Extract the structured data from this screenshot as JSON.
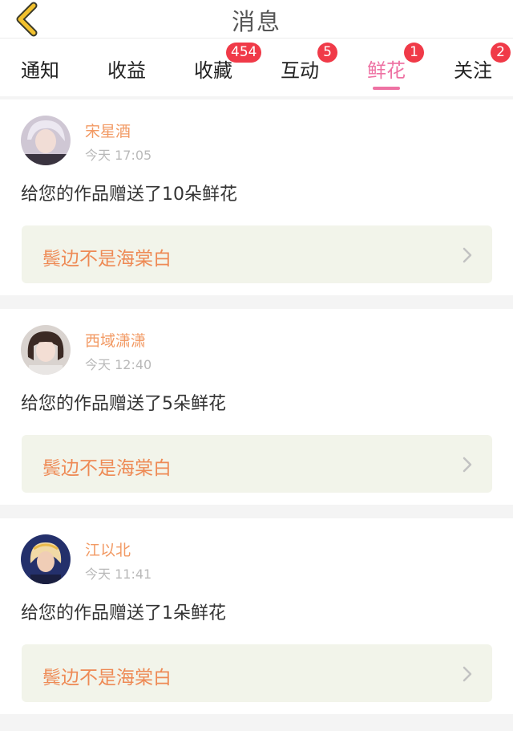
{
  "header": {
    "title": "消息",
    "back_icon": "chevron-left-icon",
    "back_color": "#f2c12e"
  },
  "tabs": [
    {
      "label": "通知",
      "badge": "",
      "active": false
    },
    {
      "label": "收益",
      "badge": "",
      "active": false
    },
    {
      "label": "收藏",
      "badge": "454",
      "active": false
    },
    {
      "label": "互动",
      "badge": "5",
      "active": false
    },
    {
      "label": "鲜花",
      "badge": "1",
      "active": true
    },
    {
      "label": "关注",
      "badge": "2",
      "active": false
    }
  ],
  "colors": {
    "accent": "#ee72a3",
    "badge": "#f03a48",
    "username": "#f29a64",
    "work_bg": "#f2f4ea"
  },
  "messages": [
    {
      "username": "宋星酒",
      "time": "今天 17:05",
      "text": "给您的作品赠送了10朵鲜花",
      "work_title": "鬓边不是海棠白",
      "avatar_icon": "user-avatar"
    },
    {
      "username": "西域潇潇",
      "time": "今天 12:40",
      "text": "给您的作品赠送了5朵鲜花",
      "work_title": "鬓边不是海棠白",
      "avatar_icon": "user-avatar"
    },
    {
      "username": "江以北",
      "time": "今天 11:41",
      "text": "给您的作品赠送了1朵鲜花",
      "work_title": "鬓边不是海棠白",
      "avatar_icon": "user-avatar"
    }
  ]
}
